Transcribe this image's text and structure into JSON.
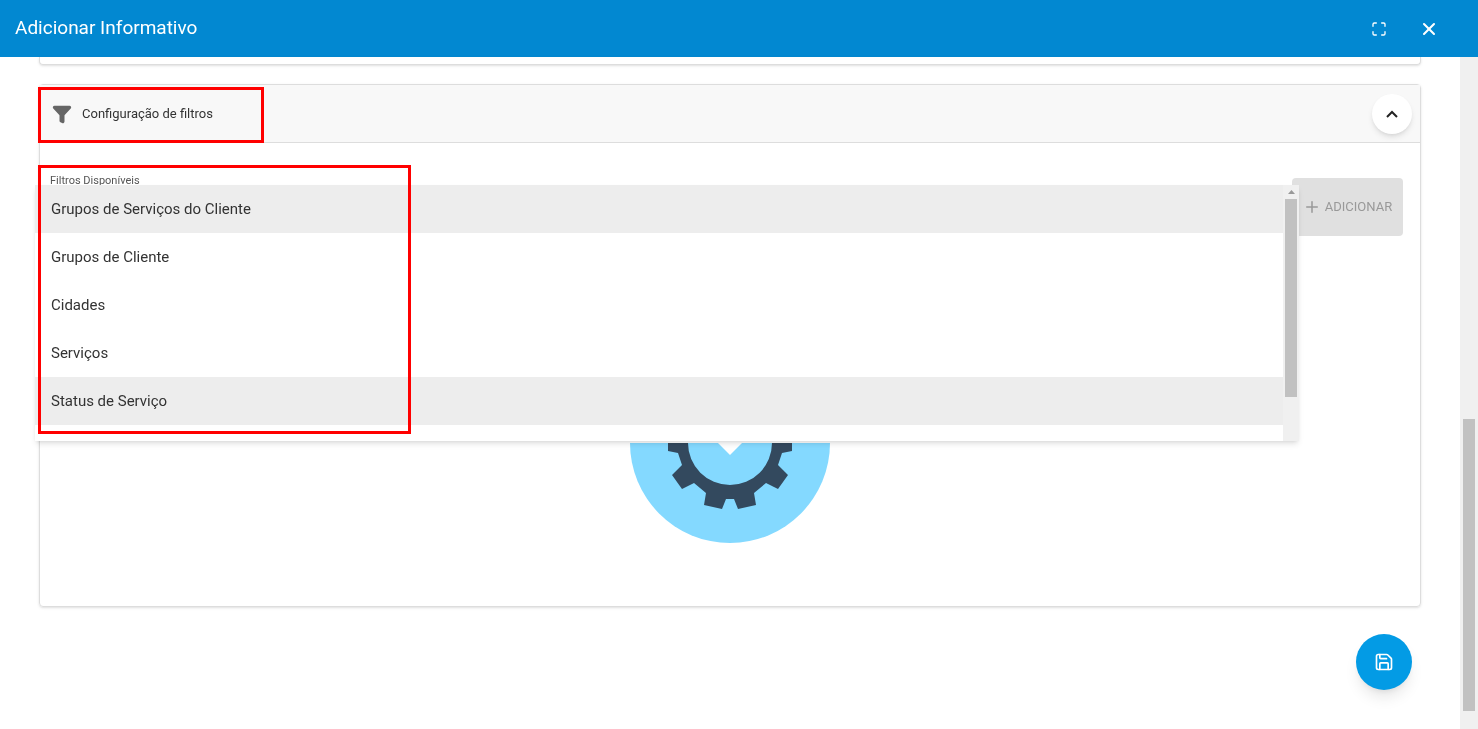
{
  "window": {
    "title": "Adicionar Informativo"
  },
  "filter_panel": {
    "title": "Configuração de filtros",
    "expanded": true,
    "field_label": "Filtros Disponíveis",
    "add_button": "ADICIONAR",
    "add_disabled": true
  },
  "dropdown_options": [
    {
      "label": "Grupos de Serviços do Cliente",
      "selected": true
    },
    {
      "label": "Grupos de Cliente",
      "selected": false
    },
    {
      "label": "Cidades",
      "selected": false
    },
    {
      "label": "Serviços",
      "selected": false
    },
    {
      "label": "Status de Serviço",
      "selected": true
    }
  ]
}
